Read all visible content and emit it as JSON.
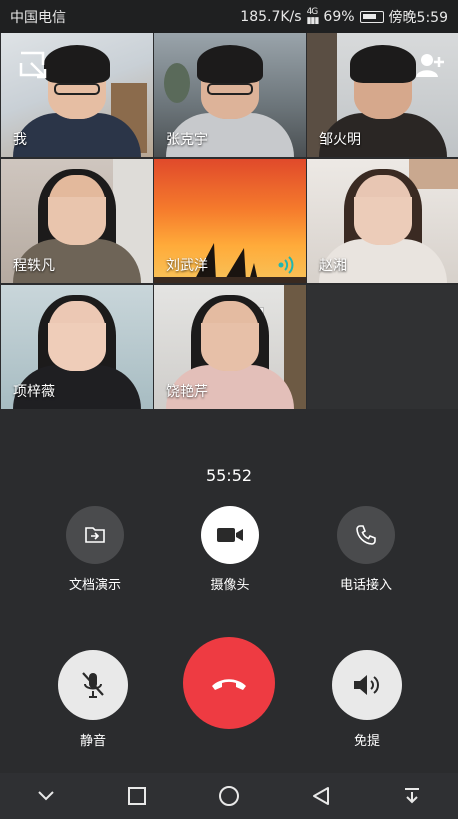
{
  "status_bar": {
    "carrier": "中国电信",
    "speed": "185.7K/s",
    "network": "4G",
    "battery": "69%",
    "time": "傍晚5:59"
  },
  "participants": [
    {
      "name": "我"
    },
    {
      "name": "张克宇"
    },
    {
      "name": "邹火明"
    },
    {
      "name": "程轶凡"
    },
    {
      "name": "刘武洋"
    },
    {
      "name": "赵湘"
    },
    {
      "name": "项梓薇"
    },
    {
      "name": "饶艳芹"
    }
  ],
  "call": {
    "duration": "55:52"
  },
  "controls": {
    "share_doc": "文档演示",
    "camera": "摄像头",
    "phone_in": "电话接入",
    "mute": "静音",
    "speaker": "免提"
  },
  "colors": {
    "hangup": "#ee3b42",
    "background": "#2b2c2e",
    "speaking_indicator": "#21b6b0"
  },
  "icons": [
    "minimize-window-icon",
    "add-person-icon",
    "speaking-wave-icon",
    "file-share-icon",
    "video-camera-icon",
    "phone-icon",
    "mic-off-icon",
    "hang-up-icon",
    "speaker-icon",
    "chevron-down-icon",
    "square-icon",
    "circle-icon",
    "back-triangle-icon",
    "notification-pull-icon"
  ]
}
